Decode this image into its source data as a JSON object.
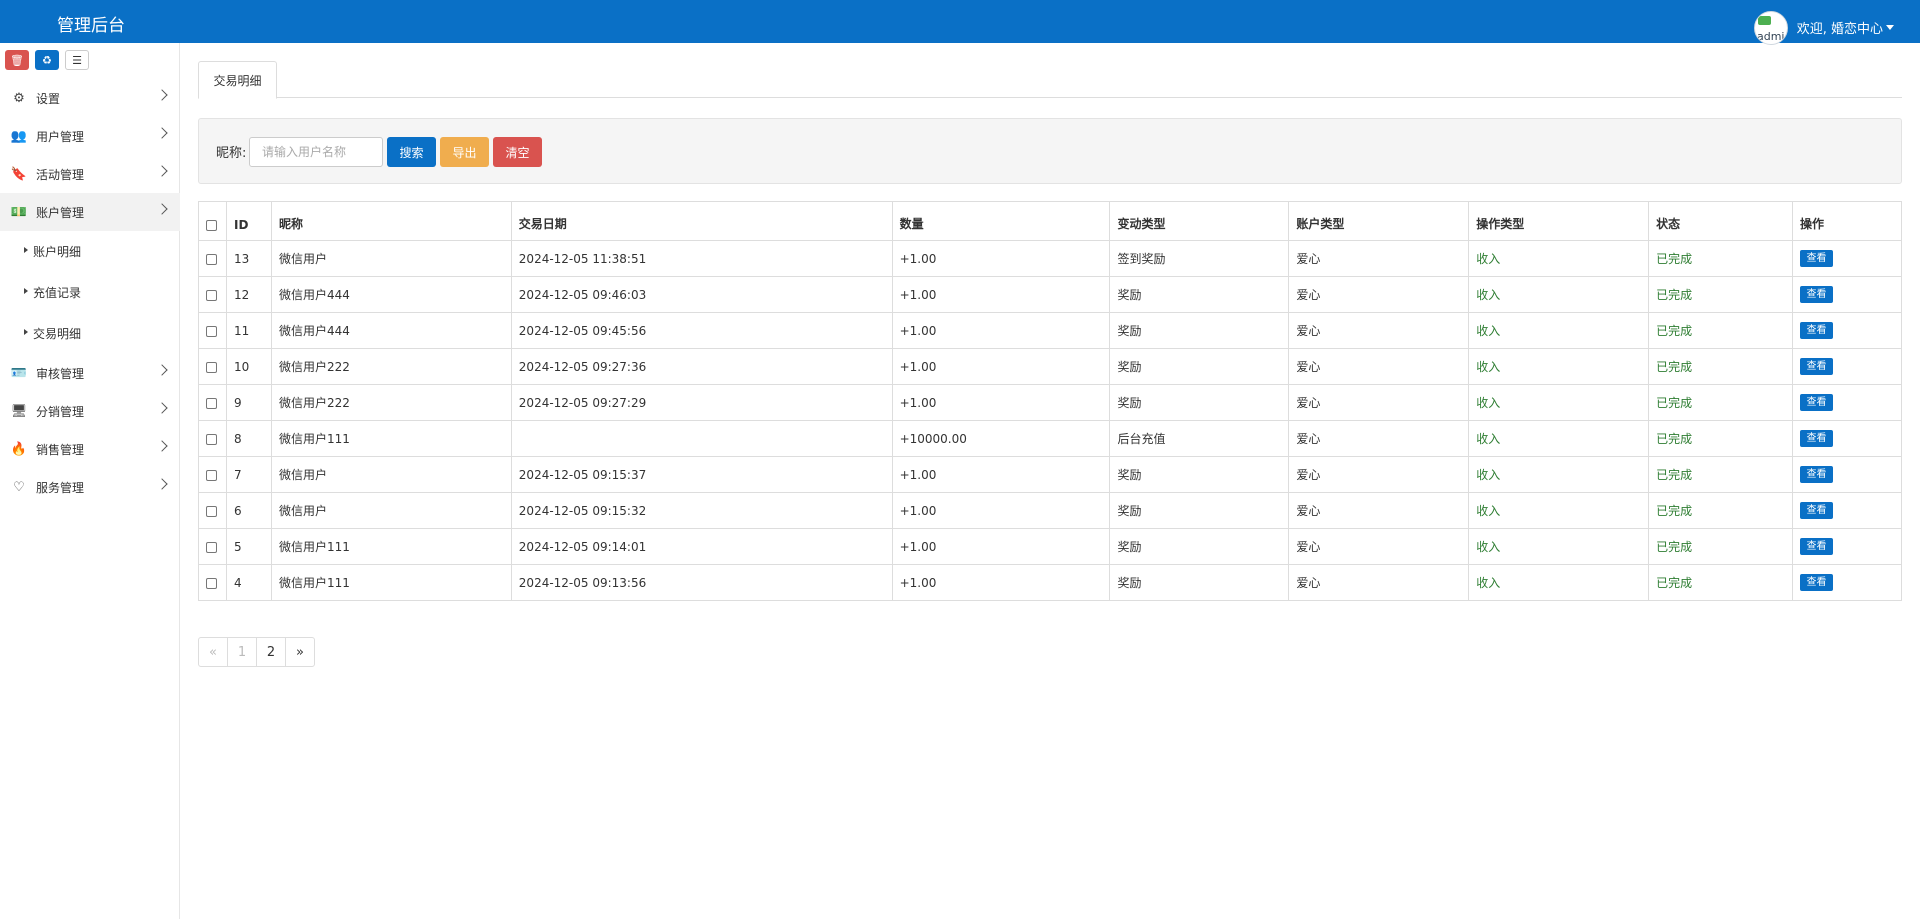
{
  "header": {
    "brand": "管理后台",
    "avatar_text": "admi",
    "welcome": "欢迎, 婚恋中心"
  },
  "sidebar": {
    "tools": [
      "trash-icon",
      "recycle-icon",
      "list-icon"
    ],
    "items": [
      {
        "label": "设置",
        "icon": "⚙"
      },
      {
        "label": "用户管理",
        "icon": "👥"
      },
      {
        "label": "活动管理",
        "icon": "🔖"
      },
      {
        "label": "账户管理",
        "icon": "💵"
      },
      {
        "label": "审核管理",
        "icon": "🪪"
      },
      {
        "label": "分销管理",
        "icon": "🖥"
      },
      {
        "label": "销售管理",
        "icon": "🔥"
      },
      {
        "label": "服务管理",
        "icon": "♡"
      }
    ],
    "sub_items": [
      "账户明细",
      "充值记录",
      "交易明细"
    ]
  },
  "tab": {
    "label": "交易明细"
  },
  "search": {
    "label": "昵称:",
    "placeholder": "请输入用户名称",
    "search_btn": "搜索",
    "export_btn": "导出",
    "clear_btn": "清空"
  },
  "table": {
    "headers": [
      "ID",
      "昵称",
      "交易日期",
      "数量",
      "变动类型",
      "账户类型",
      "操作类型",
      "状态",
      "操作"
    ],
    "rows": [
      [
        "13",
        "微信用户",
        "2024-12-05 11:38:51",
        "+1.00",
        "签到奖励",
        "爱心",
        "收入",
        "已完成",
        "查看"
      ],
      [
        "12",
        "微信用户444",
        "2024-12-05 09:46:03",
        "+1.00",
        "奖励",
        "爱心",
        "收入",
        "已完成",
        "查看"
      ],
      [
        "11",
        "微信用户444",
        "2024-12-05 09:45:56",
        "+1.00",
        "奖励",
        "爱心",
        "收入",
        "已完成",
        "查看"
      ],
      [
        "10",
        "微信用户222",
        "2024-12-05 09:27:36",
        "+1.00",
        "奖励",
        "爱心",
        "收入",
        "已完成",
        "查看"
      ],
      [
        "9",
        "微信用户222",
        "2024-12-05 09:27:29",
        "+1.00",
        "奖励",
        "爱心",
        "收入",
        "已完成",
        "查看"
      ],
      [
        "8",
        "微信用户111",
        "",
        "+10000.00",
        "后台充值",
        "爱心",
        "收入",
        "已完成",
        "查看"
      ],
      [
        "7",
        "微信用户",
        "2024-12-05 09:15:37",
        "+1.00",
        "奖励",
        "爱心",
        "收入",
        "已完成",
        "查看"
      ],
      [
        "6",
        "微信用户",
        "2024-12-05 09:15:32",
        "+1.00",
        "奖励",
        "爱心",
        "收入",
        "已完成",
        "查看"
      ],
      [
        "5",
        "微信用户111",
        "2024-12-05 09:14:01",
        "+1.00",
        "奖励",
        "爱心",
        "收入",
        "已完成",
        "查看"
      ],
      [
        "4",
        "微信用户111",
        "2024-12-05 09:13:56",
        "+1.00",
        "奖励",
        "爱心",
        "收入",
        "已完成",
        "查看"
      ]
    ]
  },
  "pagination": {
    "prev": "«",
    "pages": [
      "1",
      "2"
    ],
    "next": "»"
  },
  "colors": {
    "primary": "#0a70c6",
    "warning": "#f0ad4e",
    "danger": "#d9534f",
    "success": "#2e7d32"
  }
}
